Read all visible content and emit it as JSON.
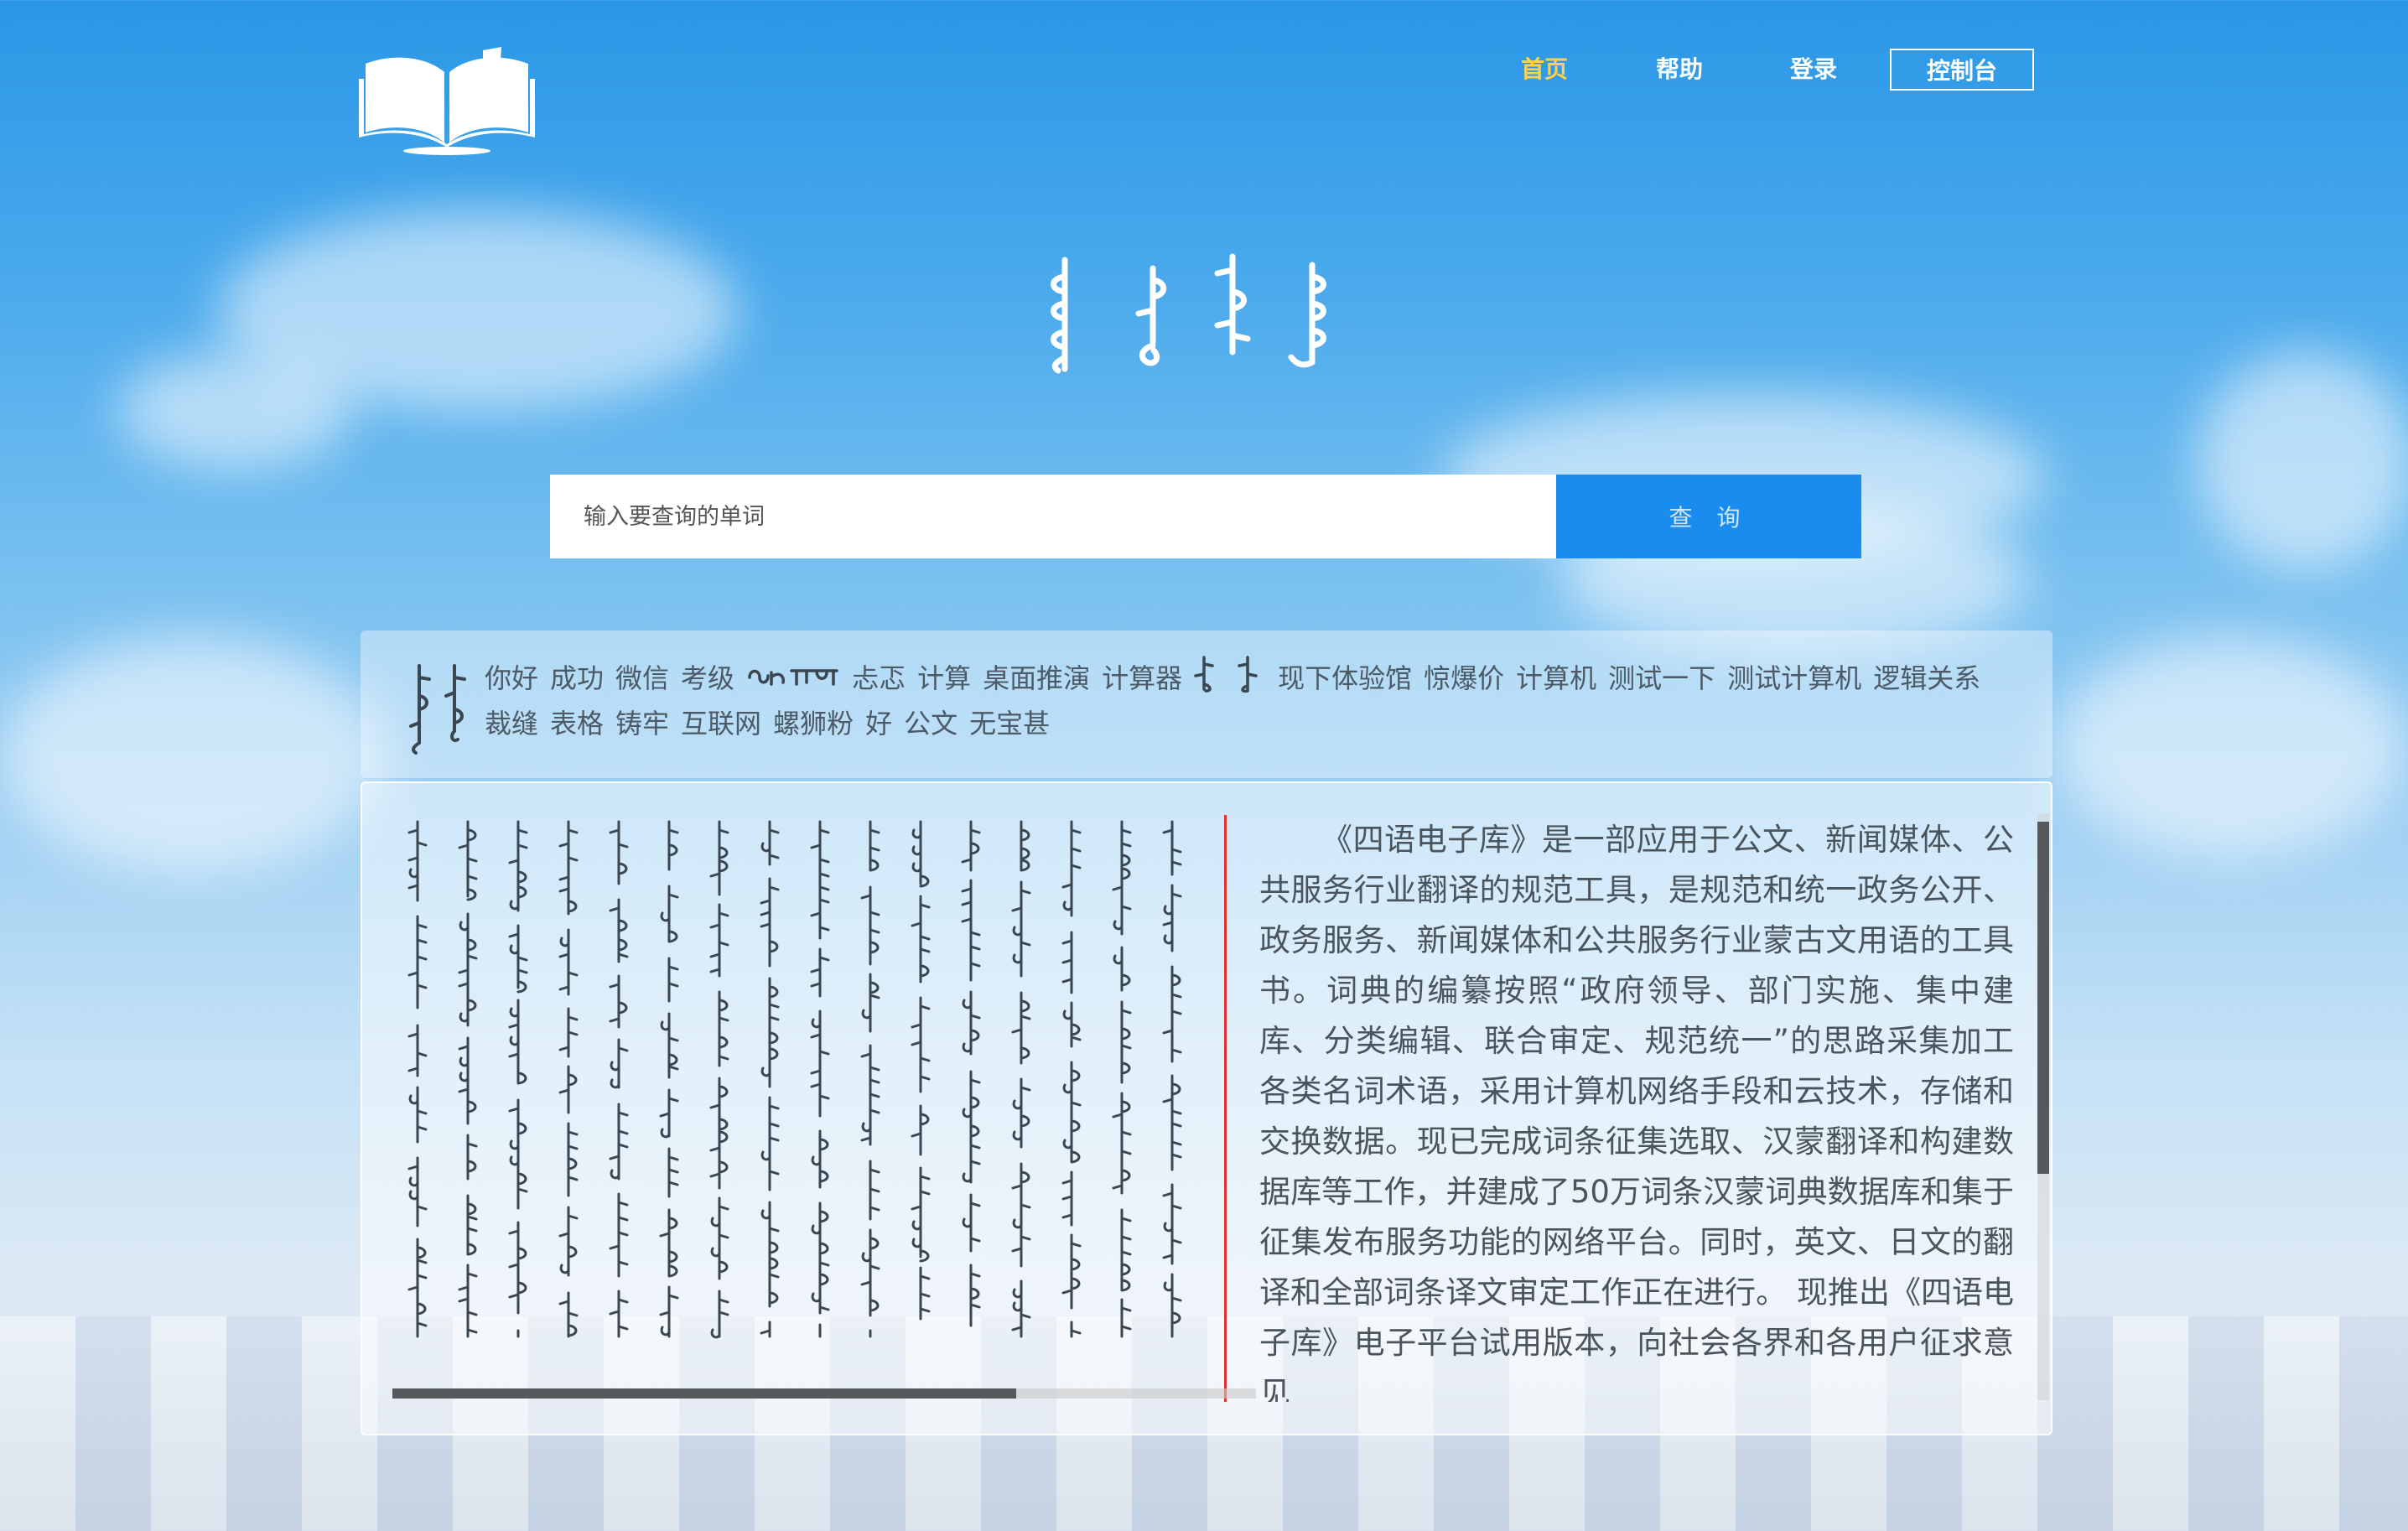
{
  "nav": {
    "home": "首页",
    "help": "帮助",
    "login": "登录",
    "console": "控制台"
  },
  "colors": {
    "nav_active": "#ffd24a",
    "search_button": "#1a8cee",
    "scroll_accent": "#e03030"
  },
  "icons": {
    "logo": "open-book-icon"
  },
  "search": {
    "placeholder": "输入要查询的单词",
    "button_label": "查 询"
  },
  "hot_words": {
    "items": [
      "你好",
      "成功",
      "微信",
      "考级",
      "忐忑",
      "计算",
      "桌面推演",
      "计算器",
      "现下体验馆",
      "惊爆价",
      "计算机",
      "测试一下",
      "测试计算机",
      "逻辑关系",
      "裁缝",
      "表格",
      "铸牢",
      "互联网",
      "螺狮粉",
      "好",
      "公文",
      "无宝甚"
    ]
  },
  "content": {
    "intro": "《四语电子库》是一部应用于公文、新闻媒体、公共服务行业翻译的规范工具，是规范和统一政务公开、政务服务、新闻媒体和公共服务行业蒙古文用语的工具书。词典的编纂按照“政府领导、部门实施、集中建库、分类编辑、联合审定、规范统一”的思路采集加工各类名词术语，采用计算机网络手段和云技术，存储和交换数据。现已完成词条征集选取、汉蒙翻译和构建数据库等工作，并建成了50万词条汉蒙词典数据库和集于征集发布服务功能的网络平台。同时，英文、日文的翻译和全部词条译文审定工作正在进行。 现推出《四语电子库》电子平台试用版本，向社会各界和各用户征求意见"
  }
}
